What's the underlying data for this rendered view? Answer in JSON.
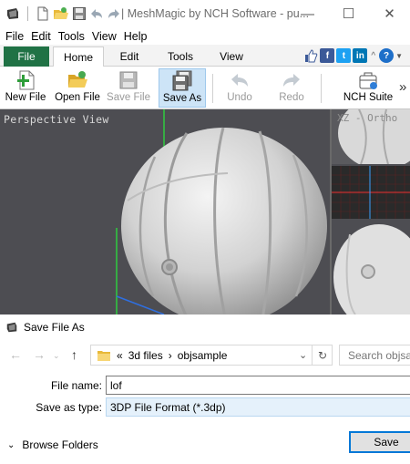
{
  "window": {
    "title": "| MeshMagic by NCH Software - pu...",
    "min_icon": "—",
    "max_icon": "☐",
    "close_icon": "✕"
  },
  "menubar": [
    "File",
    "Edit",
    "Tools",
    "View",
    "Help"
  ],
  "ribbon": {
    "tabs": {
      "file": "File",
      "home": "Home",
      "edit": "Edit",
      "tools": "Tools",
      "view": "View"
    },
    "social": {
      "facebook": "f",
      "twitter": "t",
      "linkedin": "in",
      "help": "?"
    },
    "buttons": {
      "new_file": "New File",
      "open_file": "Open File",
      "save_file": "Save File",
      "save_as": "Save As",
      "undo": "Undo",
      "redo": "Redo",
      "nch_suite": "NCH Suite"
    },
    "more": "»"
  },
  "viewport": {
    "main_label": "Perspective View",
    "side_label": "XZ - Ortho"
  },
  "dialog": {
    "title": "Save File As",
    "breadcrumb": [
      "«",
      "3d files",
      "›",
      "objsample"
    ],
    "search_placeholder": "Search objsample",
    "file_name_label": "File name:",
    "file_name_value": "lof",
    "save_type_label": "Save as type:",
    "save_type_value": "3DP File Format (*.3dp)",
    "browse_folders": "Browse Folders",
    "save_button": "Save"
  },
  "colors": {
    "file_tab": "#207245",
    "accent": "#0078d7",
    "viewport_bg": "#4d4d52"
  }
}
